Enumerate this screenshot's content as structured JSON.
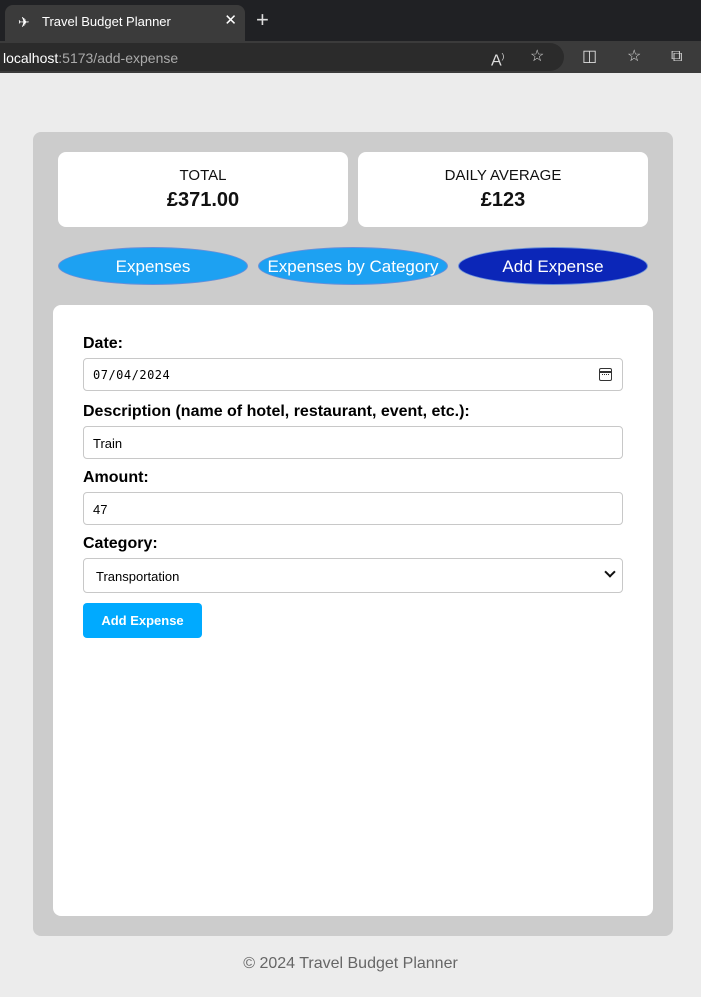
{
  "browser": {
    "tab_title": "Travel Budget Planner",
    "tab_close": "✕",
    "new_tab": "+",
    "url_host": "localhost",
    "url_path": ":5173/add-expense"
  },
  "stats": {
    "total_label": "TOTAL",
    "total_value": "£371.00",
    "daily_label": "DAILY AVERAGE",
    "daily_value": "£123"
  },
  "nav": {
    "expenses": "Expenses",
    "by_category": "Expenses by Category",
    "add_expense": "Add Expense"
  },
  "form": {
    "date_label": "Date:",
    "date_value": "07/04/2024",
    "description_label": "Description (name of hotel, restaurant, event, etc.):",
    "description_value": "Train",
    "amount_label": "Amount:",
    "amount_value": "47",
    "category_label": "Category:",
    "category_value": "Transportation",
    "submit_label": "Add Expense"
  },
  "footer": "© 2024 Travel Budget Planner",
  "colors": {
    "nav_active": "#0b26b8",
    "nav_inactive": "#1da1f2",
    "submit": "#00aaff",
    "card_bg": "#cccccc"
  }
}
